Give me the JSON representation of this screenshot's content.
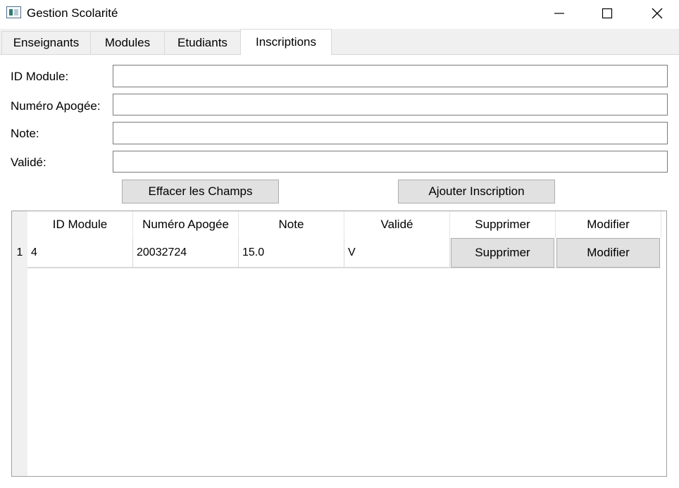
{
  "window": {
    "title": "Gestion Scolarité"
  },
  "tabs": [
    {
      "label": "Enseignants",
      "active": false
    },
    {
      "label": "Modules",
      "active": false
    },
    {
      "label": "Etudiants",
      "active": false
    },
    {
      "label": "Inscriptions",
      "active": true
    }
  ],
  "form": {
    "id_module_label": "ID Module:",
    "apogee_label": "Numéro Apogée:",
    "note_label": "Note:",
    "valide_label": "Validé:",
    "id_module_value": "",
    "apogee_value": "",
    "note_value": "",
    "valide_value": ""
  },
  "buttons": {
    "clear": "Effacer les Champs",
    "add": "Ajouter Inscription"
  },
  "table": {
    "headers": [
      "ID Module",
      "Numéro Apogée",
      "Note",
      "Validé",
      "Supprimer",
      "Modifier"
    ],
    "rows": [
      {
        "row_number": "1",
        "id_module": "4",
        "apogee": "20032724",
        "note": "15.0",
        "valide": "V",
        "delete_label": "Supprimer",
        "edit_label": "Modifier"
      }
    ]
  }
}
